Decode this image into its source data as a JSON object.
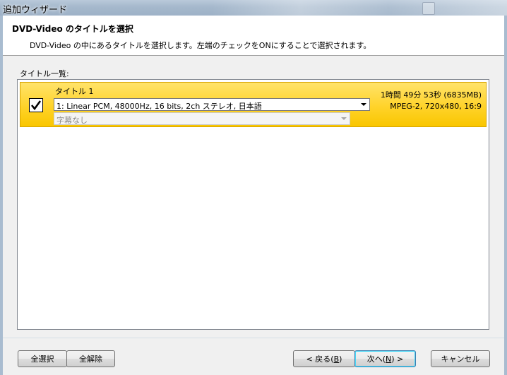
{
  "window": {
    "title": "追加ウィザード"
  },
  "header": {
    "title": "DVD-Video のタイトルを選択",
    "description": "DVD-Video の中にあるタイトルを選択します。左端のチェックをONにすることで選択されます。"
  },
  "list": {
    "label": "タイトル一覧:",
    "items": [
      {
        "checked": true,
        "title": "タイトル 1",
        "audio": "1: Linear PCM,  48000Hz,  16 bits,  2ch ステレオ, 日本語",
        "subtitle": "字幕なし",
        "duration": "1時間 49分 53秒 (6835MB)",
        "format": "MPEG-2, 720x480, 16:9"
      }
    ]
  },
  "buttons": {
    "select_all": "全選択",
    "deselect_all": "全解除",
    "back": "< 戻る(",
    "back_key": "B",
    "next": "次へ(",
    "next_key": "N",
    "cancel": "キャンセル"
  }
}
